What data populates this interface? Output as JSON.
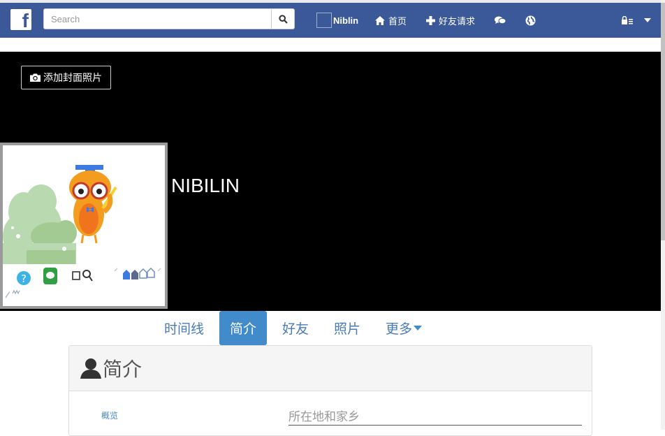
{
  "navbar": {
    "logo": "f",
    "search_placeholder": "Search",
    "profile_name": "Niblin",
    "home_label": "首页",
    "friend_requests_label": "好友请求"
  },
  "cover": {
    "add_cover_label": "添加封面照片",
    "user_name": "NIBILIN"
  },
  "tabs": {
    "timeline": "时间线",
    "about": "简介",
    "friends": "好友",
    "photos": "照片",
    "more": "更多"
  },
  "about_panel": {
    "title": "简介",
    "overview_label": "概览",
    "location_placeholder": "所在地和家乡"
  },
  "colors": {
    "navbar": "#3b5998",
    "active_tab": "#428bca",
    "link": "#4a7bb4"
  }
}
